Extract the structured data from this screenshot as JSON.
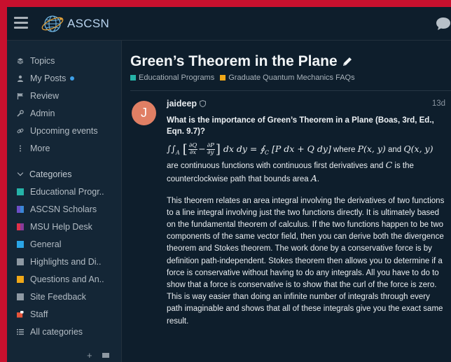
{
  "header": {
    "site_name": "ASCSN"
  },
  "sidebar": {
    "nav": [
      {
        "label": "Topics",
        "icon": "layers-icon"
      },
      {
        "label": "My Posts",
        "icon": "user-icon"
      },
      {
        "label": "Review",
        "icon": "flag-icon"
      },
      {
        "label": "Admin",
        "icon": "wrench-icon"
      },
      {
        "label": "Upcoming events",
        "icon": "link-icon"
      },
      {
        "label": "More",
        "icon": "ellipsis-vertical-icon"
      }
    ],
    "categories_label": "Categories",
    "categories": [
      {
        "label": "Educational Progr..",
        "color": "#25b3a8"
      },
      {
        "label": "ASCSN Scholars",
        "color": "#6c4fc7"
      },
      {
        "label": "MSU Help Desk",
        "color": "#e0314b"
      },
      {
        "label": "General",
        "color": "#2aa5e6"
      },
      {
        "label": "Highlights and Di..",
        "color": "#8e99a3"
      },
      {
        "label": "Questions and An..",
        "color": "#f0a818"
      },
      {
        "label": "Site Feedback",
        "color": "#8e99a3"
      },
      {
        "label": "Staff",
        "color": "#e8553a"
      }
    ],
    "all_categories_label": "All categories"
  },
  "topic": {
    "title": "Green’s Theorem in the Plane",
    "breadcrumbs": [
      {
        "label": "Educational Programs",
        "color": "#25b3a8"
      },
      {
        "label": "Graduate Quantum Mechanics FAQs",
        "color": "#f0a818"
      }
    ]
  },
  "post": {
    "avatar_letter": "J",
    "author": "jaideep",
    "age": "13d",
    "question": "What is the importance of Green’s Theorem in a Plane (Boas, 3rd, Ed., Eqn. 9.7)?",
    "formula": {
      "text_where": "where",
      "p_of": "P(x, y)",
      "and": "and",
      "q_of": "Q(x, y)",
      "text_are": "are continuous functions with continuous first derivatives and",
      "c_var": "C",
      "text_is": "is the counterclockwise path that bounds area",
      "a_var": "A",
      "period": "."
    },
    "paragraph": "This theorem relates an area integral involving the derivatives of two functions to a line integral involving just the two functions directly. It is ultimately based on the fundamental theorem of calculus. If the two functions happen to be two components of the same vector field, then you can derive both the divergence theorem and Stokes theorem. The work done by a conservative force is by definition path-independent. Stokes theorem then allows you to determine if a force is conservative without having to do any integrals. All you have to do to show that a force is conservative is to show that the curl of the force is zero. This is way easier than doing an infinite number of integrals through every path imaginable and shows that all of these integrals give you the exact same result."
  }
}
